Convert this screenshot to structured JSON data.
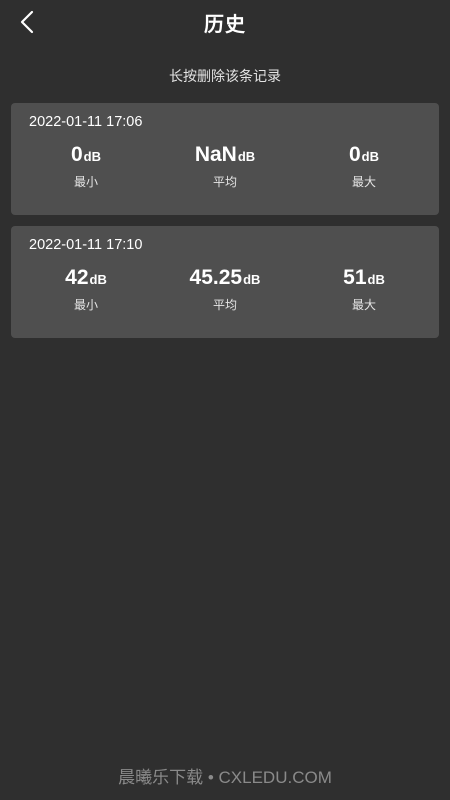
{
  "header": {
    "back_icon": "chevron-left-icon",
    "title": "历史"
  },
  "hint": "长按删除该条记录",
  "records": [
    {
      "time": "2022-01-11 17:06",
      "min": {
        "value": "0",
        "unit": "dB",
        "label": "最小"
      },
      "avg": {
        "value": "NaN",
        "unit": "dB",
        "label": "平均"
      },
      "max": {
        "value": "0",
        "unit": "dB",
        "label": "最大"
      }
    },
    {
      "time": "2022-01-11 17:10",
      "min": {
        "value": "42",
        "unit": "dB",
        "label": "最小"
      },
      "avg": {
        "value": "45.25",
        "unit": "dB",
        "label": "平均"
      },
      "max": {
        "value": "51",
        "unit": "dB",
        "label": "最大"
      }
    }
  ],
  "watermark": "晨曦乐下载 • CXLEDU.COM",
  "colors": {
    "background": "#2f2f2f",
    "card": "#4f4f4f",
    "text": "#ffffff",
    "watermark": "#8a8a8a"
  }
}
